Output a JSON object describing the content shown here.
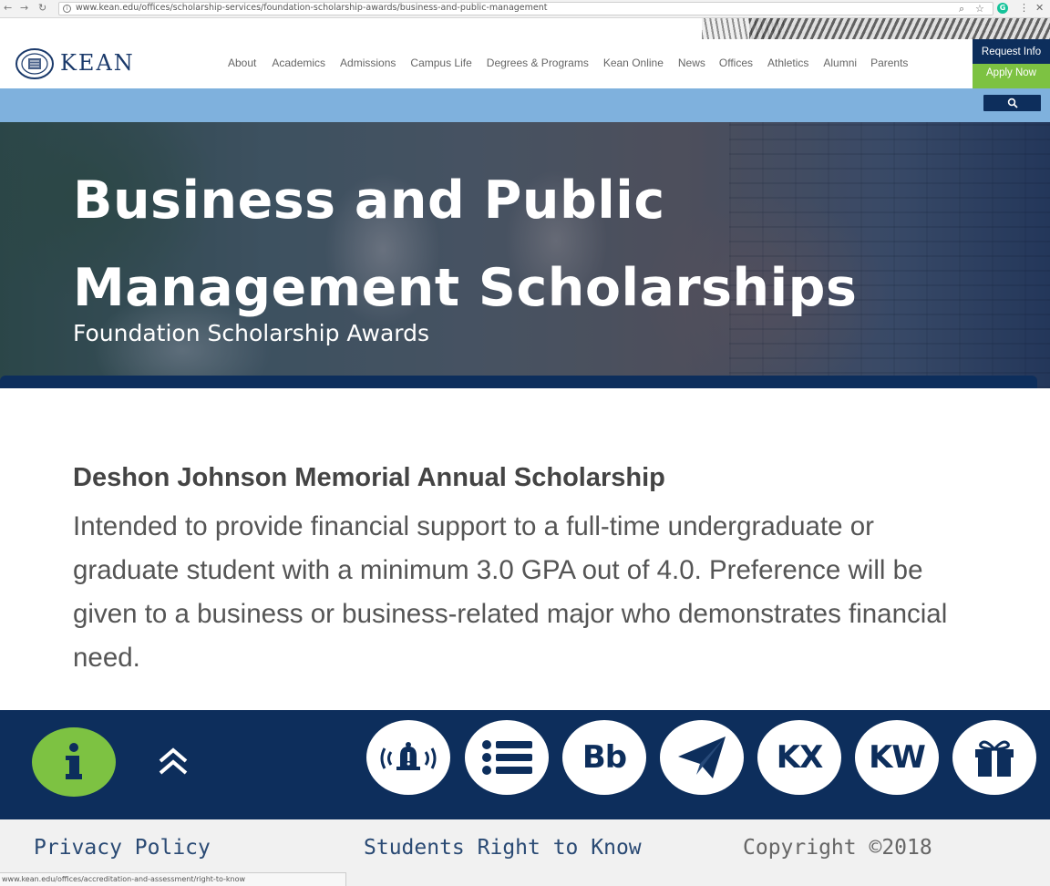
{
  "browser": {
    "url": "www.kean.edu/offices/scholarship-services/foundation-scholarship-awards/business-and-public-management",
    "status_url": "www.kean.edu/offices/accreditation-and-assessment/right-to-know"
  },
  "header": {
    "logo_text": "KEAN",
    "nav": [
      "About",
      "Academics",
      "Admissions",
      "Campus Life",
      "Degrees & Programs",
      "Kean Online",
      "News",
      "Offices",
      "Athletics",
      "Alumni",
      "Parents"
    ],
    "request_info": "Request Info",
    "apply_now": "Apply Now"
  },
  "hero": {
    "title": "Business and Public Management Scholarships",
    "subtitle": "Foundation Scholarship Awards"
  },
  "content": {
    "scholarship_title": "Deshon Johnson Memorial Annual Scholarship",
    "scholarship_description": "Intended to provide financial support to a full-time undergraduate or graduate student with a minimum 3.0 GPA out of 4.0. Preference will be given to a business or business-related major who demonstrates financial need."
  },
  "footer": {
    "quick_links": [
      {
        "icon": "alert-bell-icon"
      },
      {
        "icon": "list-icon"
      },
      {
        "icon": "blackboard-icon",
        "label": "Bb"
      },
      {
        "icon": "paper-plane-icon"
      },
      {
        "icon": "kx-icon",
        "label": "KX"
      },
      {
        "icon": "kw-icon",
        "label": "KW"
      },
      {
        "icon": "gift-icon"
      }
    ],
    "privacy": "Privacy Policy",
    "right_to_know": "Students Right to Know",
    "copyright": "Copyright ©2018"
  },
  "colors": {
    "navy": "#0d2e5c",
    "green": "#7dc242",
    "sky": "#7fb1dd"
  }
}
